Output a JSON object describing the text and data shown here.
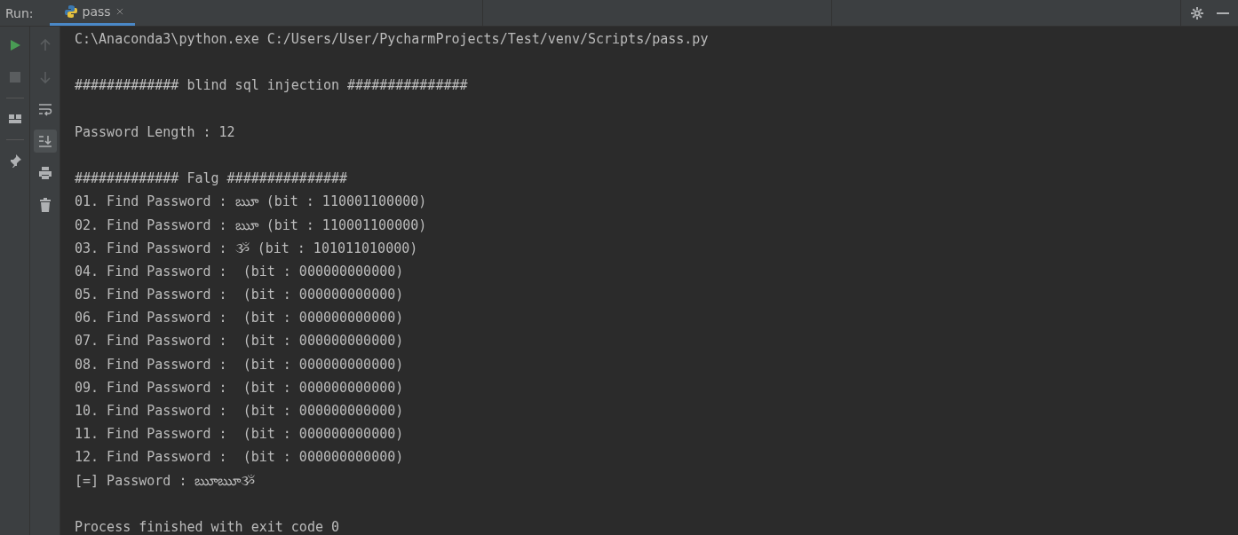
{
  "run_bar": {
    "label": "Run:",
    "tabs": [
      {
        "label": "pass",
        "selected": true
      }
    ]
  },
  "console": {
    "blocks": [
      {
        "lines": [
          "C:\\Anaconda3\\python.exe C:/Users/User/PycharmProjects/Test/venv/Scripts/pass.py"
        ]
      },
      {
        "lines": [
          "############# blind sql injection ###############"
        ]
      },
      {
        "lines": [
          "Password Length : 12"
        ]
      },
      {
        "lines": [
          "############# Falg ###############",
          "01. Find Password : ౠ (bit : 110001100000)",
          "02. Find Password : ౠ (bit : 110001100000)",
          "03. Find Password : ૐ (bit : 101011010000)",
          "04. Find Password :  (bit : 000000000000)",
          "05. Find Password :  (bit : 000000000000)",
          "06. Find Password :  (bit : 000000000000)",
          "07. Find Password :  (bit : 000000000000)",
          "08. Find Password :  (bit : 000000000000)",
          "09. Find Password :  (bit : 000000000000)",
          "10. Find Password :  (bit : 000000000000)",
          "11. Find Password :  (bit : 000000000000)",
          "12. Find Password :  (bit : 000000000000)",
          "[=] Password : ౠౠૐ"
        ]
      },
      {
        "lines": [
          "Process finished with exit code 0"
        ]
      }
    ]
  }
}
